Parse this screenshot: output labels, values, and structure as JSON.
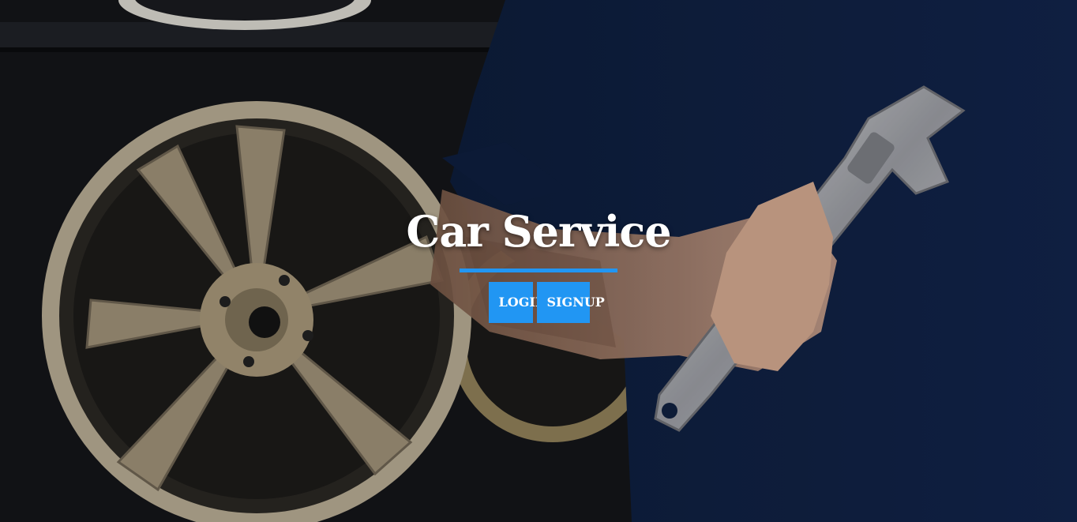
{
  "hero": {
    "title": "Car Service",
    "accent_color": "#2196f3"
  },
  "buttons": {
    "login_label": "LOGIN",
    "signup_label": "SIGNUP"
  },
  "background": {
    "description_icons": [
      "wheel-icon",
      "wrench-icon"
    ]
  }
}
